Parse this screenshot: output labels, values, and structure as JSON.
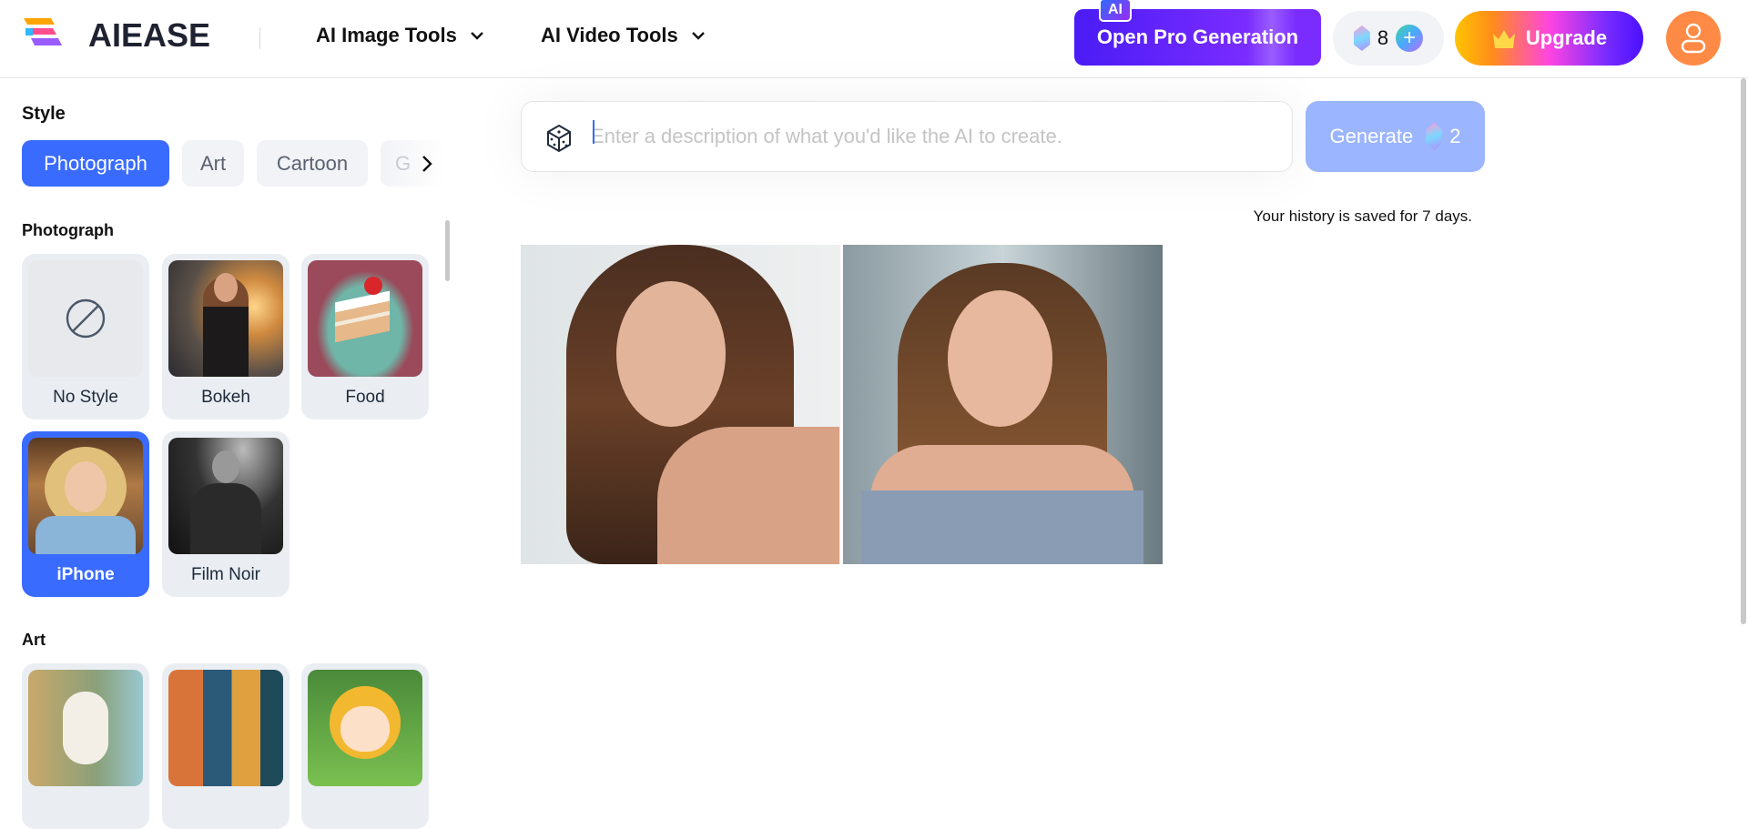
{
  "header": {
    "logo_text": "AIEASE",
    "nav": [
      {
        "label": "AI Image Tools"
      },
      {
        "label": "AI Video Tools"
      }
    ],
    "pro_button": "Open Pro Generation",
    "pro_badge": "AI",
    "credits": "8",
    "upgrade": "Upgrade"
  },
  "sidebar": {
    "style_label": "Style",
    "tabs": [
      "Photograph",
      "Art",
      "Cartoon",
      "G"
    ],
    "active_tab": "Photograph",
    "photograph_label": "Photograph",
    "photograph_styles": [
      {
        "label": "No Style"
      },
      {
        "label": "Bokeh"
      },
      {
        "label": "Food"
      },
      {
        "label": "iPhone",
        "selected": true
      },
      {
        "label": "Film Noir"
      }
    ],
    "art_label": "Art"
  },
  "main": {
    "prompt_placeholder": "Enter a description of what you'd like the AI to create.",
    "prompt_value": "",
    "generate_label": "Generate",
    "generate_cost": "2",
    "history_note": "Your history is saved for 7 days."
  },
  "colors": {
    "accent": "#3a6bff",
    "pro": "#6a22ff",
    "avatar": "#ff8a45"
  }
}
